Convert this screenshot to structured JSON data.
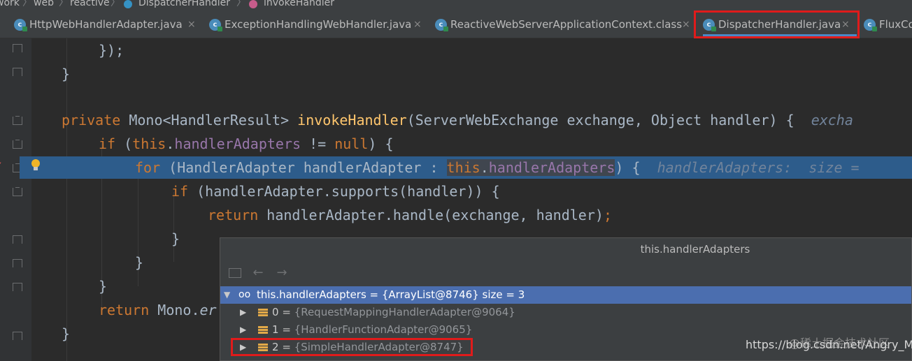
{
  "breadcrumb": {
    "items": [
      "work",
      "web",
      "reactive",
      "DispatcherHandler",
      "invokeHandler"
    ],
    "separator": "〉"
  },
  "tabs": [
    {
      "label": "HttpWebHandlerAdapter.java",
      "close": "×"
    },
    {
      "label": "ExceptionHandlingWebHandler.java",
      "close": "×"
    },
    {
      "label": "ReactiveWebServerApplicationContext.class",
      "close": "×"
    },
    {
      "label": "DispatcherHandler.java",
      "close": "×",
      "active": true
    },
    {
      "label": "FluxCo"
    }
  ],
  "code": {
    "line1": "});",
    "line2": "}",
    "sig_private": "private",
    "sig_type": " Mono<HandlerResult> ",
    "sig_name": "invokeHandler",
    "sig_params": "(ServerWebExchange exchange, Object handler) {  ",
    "sig_hint": "excha",
    "if_kw": "if",
    "if_open": " (",
    "if_this": "this",
    "if_dot": ".",
    "if_field": "handlerAdapters",
    "if_rest": " != ",
    "if_null": "null",
    "if_close": ") {",
    "for_kw": "for",
    "for_mid": " (HandlerAdapter handlerAdapter : ",
    "for_this": "this",
    "for_dot": ".",
    "for_field": "handlerAdapters",
    "for_close": ") {  ",
    "for_hint": "handlerAdapters:  size =",
    "if2_kw": "if",
    "if2_rest": " (handlerAdapter.supports(handler)) {",
    "ret_kw": "return",
    "ret_rest": " handlerAdapter.handle(exchange, handler)",
    "ret_semi": ";",
    "close1": "}",
    "close2": "}",
    "close3": "}",
    "ret2_kw": "return",
    "ret2_rest": " Mono.",
    "ret2_em": "er",
    "close4": "}"
  },
  "popup": {
    "title": "this.handlerAdapters",
    "root": {
      "name": "this.handlerAdapters",
      "eq": " = ",
      "value": "{ArrayList@8746}  size = 3"
    },
    "items": [
      {
        "index": "0",
        "eq": " = ",
        "value": "{RequestMappingHandlerAdapter@9064}"
      },
      {
        "index": "1",
        "eq": " = ",
        "value": "{HandlerFunctionAdapter@9065}"
      },
      {
        "index": "2",
        "eq": " = ",
        "value": "{SimpleHandlerAdapter@8747}"
      }
    ]
  },
  "watermark": {
    "logo": "@稀土掘金技术社区",
    "url": "https://blog.csdn.net/Angry_Mills"
  },
  "colors": {
    "highlight": "#e01b1b",
    "selection": "#2d5c8b",
    "keyword": "#cc7832"
  }
}
